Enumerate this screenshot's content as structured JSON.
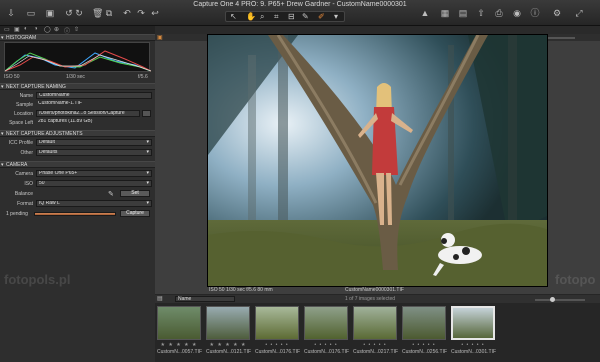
{
  "window": {
    "title": "Capture One 4 PRO: 9. P65+ Drew Gardner - CustomName0000301"
  },
  "histogram": {
    "iso": "ISO 50",
    "shutter": "1/30 sec",
    "aperture": "f/5.6",
    "section": "HISTOGRAM"
  },
  "naming": {
    "section": "NEXT CAPTURE NAMING",
    "fields": [
      {
        "label": "Name",
        "value": "CustomName"
      },
      {
        "label": "Sample",
        "value": "CustomName-1.TIF"
      },
      {
        "label": "Location",
        "value": "/Users/photokina2...o Session/Capture"
      },
      {
        "label": "Space Left",
        "value": "281 captures (11.89 GB)"
      }
    ]
  },
  "adjustments": {
    "section": "NEXT CAPTURE ADJUSTMENTS",
    "fields": [
      {
        "label": "ICC Profile",
        "value": "Default"
      },
      {
        "label": "Other",
        "value": "Defaults"
      }
    ]
  },
  "camera": {
    "section": "CAMERA",
    "fields": [
      {
        "label": "Camera",
        "value": "Phase One P65+"
      },
      {
        "label": "ISO",
        "value": "50"
      },
      {
        "label": "Balance",
        "value": ""
      },
      {
        "label": "Format",
        "value": "IQ Raw L"
      }
    ],
    "set_label": "Set",
    "pending_label": "1 pending",
    "capture_label": "Capture"
  },
  "viewer": {
    "caption_left": "ISO 50   1/30 sec   f/5.6   80 mm",
    "caption_center": "CustomName0000301.TIF"
  },
  "browser": {
    "sort_label": "Name",
    "count_text": "1 of 7 images selected",
    "thumbs": [
      {
        "name": "CustomN...0057.TIF",
        "stars": "★ ★ ★ ★ ★"
      },
      {
        "name": "CustomN...0121.TIF",
        "stars": "★ ★ ★ ★ ★"
      },
      {
        "name": "CustomN...0176.TIF",
        "stars": "• • • • •"
      },
      {
        "name": "CustomN...0176.TIF",
        "stars": "• • • • •"
      },
      {
        "name": "CustomN...0217.TIF",
        "stars": "• • • • •"
      },
      {
        "name": "CustomN...0256.TIF",
        "stars": "• • • • •"
      },
      {
        "name": "CustomN...0301.TIF",
        "stars": "• • • • •"
      }
    ]
  },
  "watermark": {
    "left": "fotopols.pl",
    "right": "fotopo"
  }
}
